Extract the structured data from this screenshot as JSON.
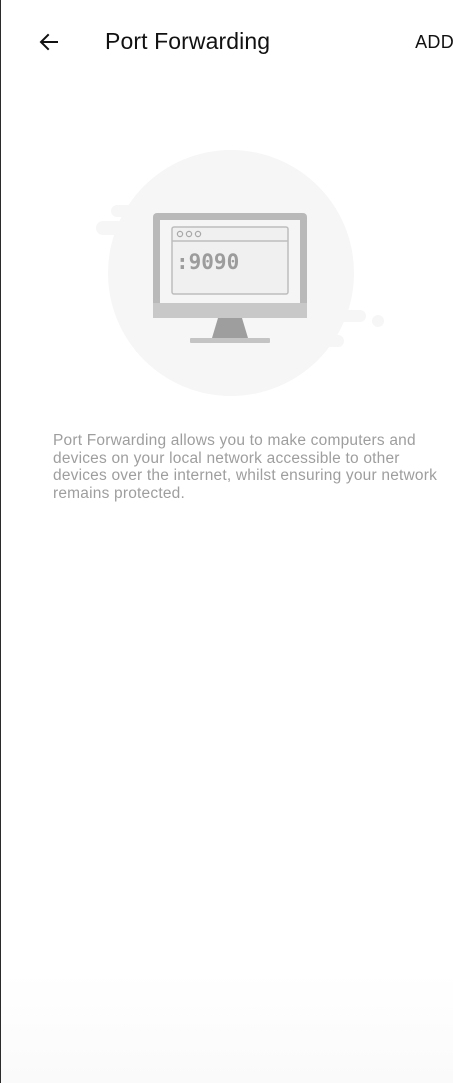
{
  "header": {
    "title": "Port Forwarding",
    "add_label": "ADD",
    "back_icon": "arrow-left-icon"
  },
  "illustration": {
    "port_text": ":9090",
    "icon": "monitor-icon"
  },
  "empty_state": {
    "description": "Port Forwarding allows you to make computers and devices on your local network accessible to other devices over the internet, whilst ensuring your network remains protected."
  },
  "colors": {
    "background": "#ffffff",
    "text_primary": "#111111",
    "text_secondary": "#9e9e9e",
    "illustration_circle": "#f6f6f6",
    "monitor_frame": "#b8b8b8"
  }
}
